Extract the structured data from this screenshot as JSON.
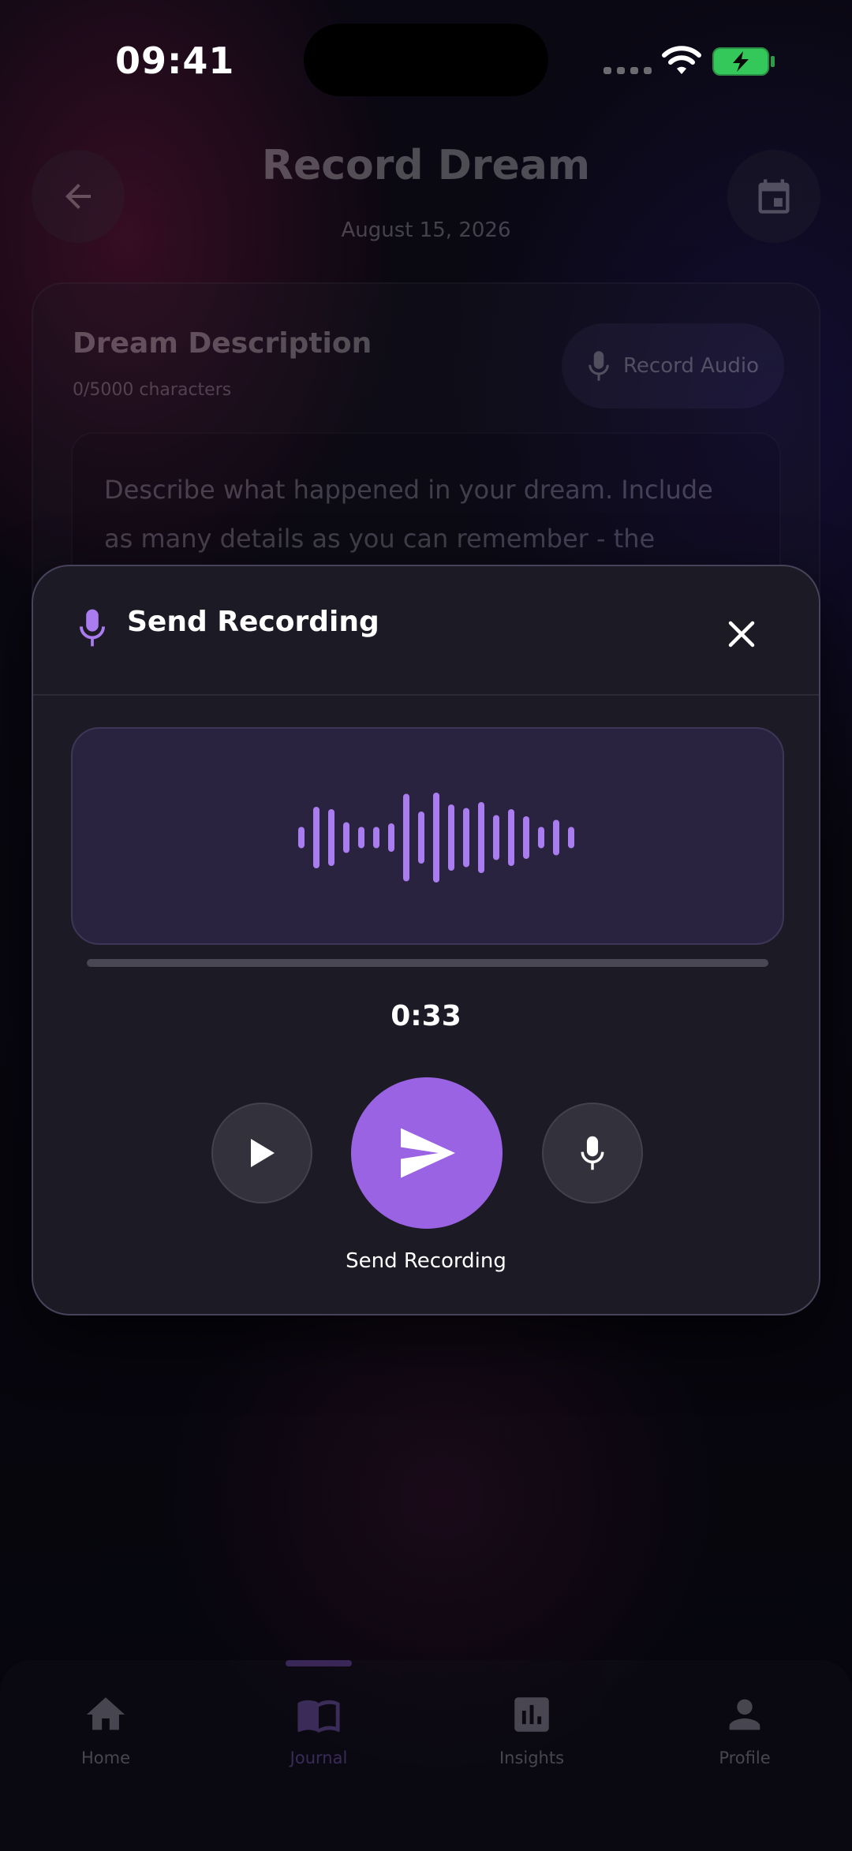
{
  "status_bar": {
    "time": "09:41"
  },
  "header": {
    "title": "Record Dream",
    "date": "August 15, 2026",
    "back_icon": "arrow-left-icon",
    "calendar_icon": "calendar-icon"
  },
  "description_card": {
    "title": "Dream Description",
    "char_count": "0/5000 characters",
    "record_audio_label": "Record Audio",
    "placeholder": "Describe what happened in your dream. Include as many details as you can remember - the people,"
  },
  "modal": {
    "title": "Send Recording",
    "timer": "0:33",
    "progress": 0,
    "send_label": "Send Recording",
    "accent_color": "#9a63e3",
    "waveform": [
      0.18,
      0.52,
      0.48,
      0.26,
      0.18,
      0.18,
      0.24,
      0.74,
      0.44,
      0.76,
      0.56,
      0.5,
      0.6,
      0.38,
      0.48,
      0.36,
      0.18,
      0.3,
      0.18
    ]
  },
  "nav": {
    "items": [
      {
        "label": "Home",
        "icon": "home-icon"
      },
      {
        "label": "Journal",
        "icon": "book-icon"
      },
      {
        "label": "Insights",
        "icon": "bar-chart-icon"
      },
      {
        "label": "Profile",
        "icon": "person-icon"
      }
    ],
    "active_index": 1
  }
}
